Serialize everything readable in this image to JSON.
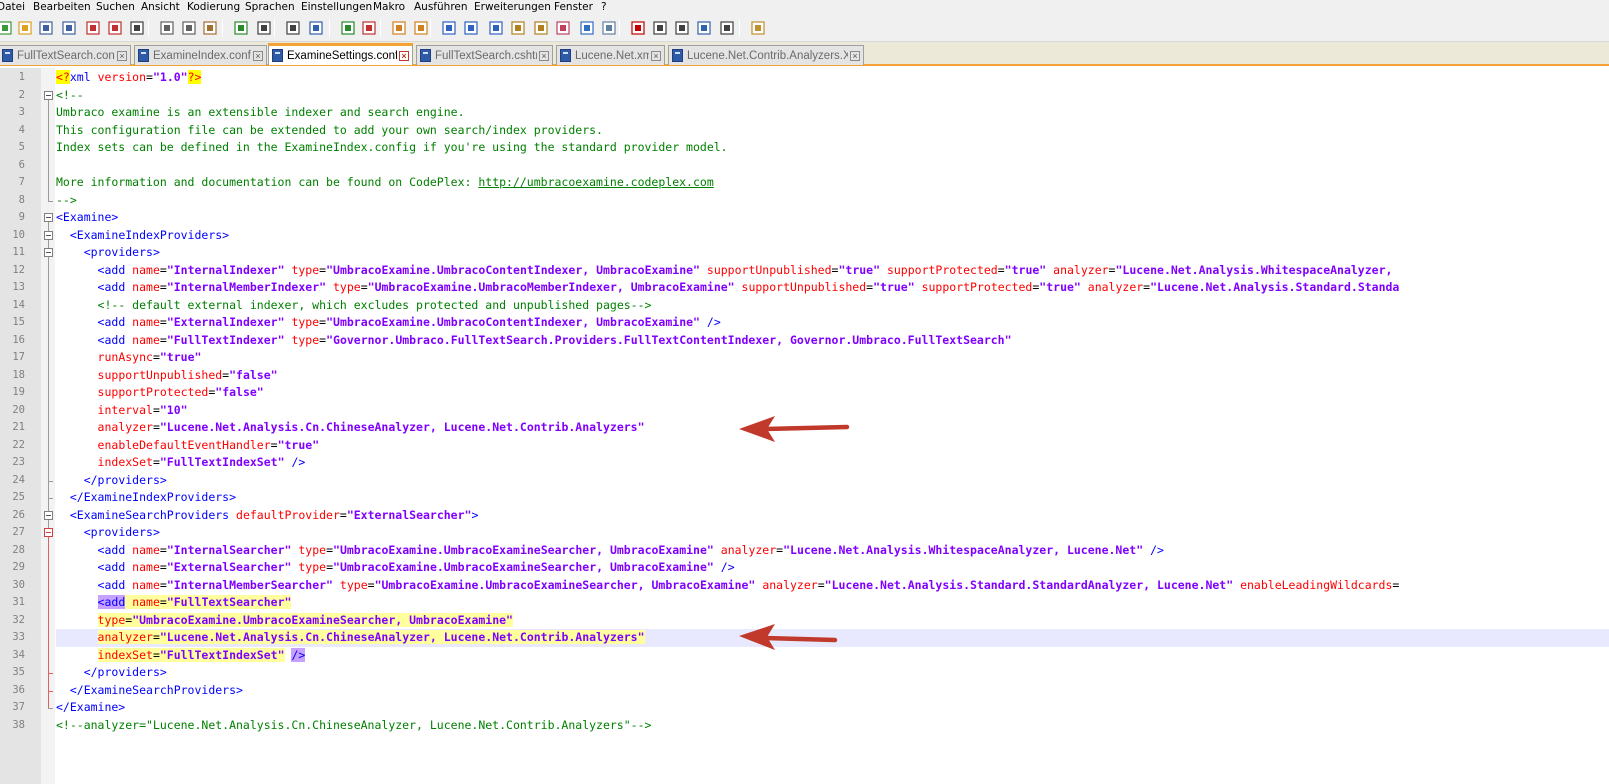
{
  "menu": [
    "Datei",
    "Bearbeiten",
    "Suchen",
    "Ansicht",
    "Kodierung",
    "Sprachen",
    "Einstellungen",
    "Makro",
    "Ausführen",
    "Erweiterungen",
    "Fenster",
    "?"
  ],
  "toolbar_icons": [
    "new-file-icon",
    "open-file-icon",
    "save-icon",
    "save-all-icon",
    "close-icon",
    "close-all-icon",
    "print-icon",
    "cut-icon",
    "copy-icon",
    "paste-icon",
    "undo-icon",
    "redo-icon",
    "find-icon",
    "replace-icon",
    "zoom-in-icon",
    "zoom-out-icon",
    "sync-vertical-icon",
    "sync-horizontal-icon",
    "word-wrap-icon",
    "show-all-chars-icon",
    "indent-guide-icon",
    "user-language-icon",
    "doc-map-icon",
    "function-list-icon",
    "folder-workspace-icon",
    "monitoring-icon",
    "record-macro-icon",
    "stop-macro-icon",
    "play-macro-icon",
    "run-macro-multiple-icon",
    "save-macro-icon",
    "plugin-icon"
  ],
  "tabs": [
    {
      "label": "FullTextSearch.config",
      "active": false
    },
    {
      "label": "ExamineIndex.config",
      "active": false
    },
    {
      "label": "ExamineSettings.config",
      "active": true
    },
    {
      "label": "FullTextSearch.cshtml",
      "active": false
    },
    {
      "label": "Lucene.Net.xml",
      "active": false
    },
    {
      "label": "Lucene.Net.Contrib.Analyzers.XML",
      "active": false
    }
  ],
  "editor": {
    "current_line": 33,
    "colors": {
      "tag": "#0000ff",
      "attribute": "#ff0000",
      "value": "#8000ff",
      "comment": "#008000",
      "current_line": "#e8e8ff",
      "annotation_arrow": "#c0392b"
    },
    "lines": [
      [
        [
          "pi",
          "<?"
        ],
        [
          "tag",
          "xml "
        ],
        [
          "attr",
          "version"
        ],
        [
          "eq",
          "="
        ],
        [
          "val",
          "\"1.0\""
        ],
        [
          "pi",
          "?>"
        ]
      ],
      [
        [
          "com",
          "<!--"
        ]
      ],
      [
        [
          "com",
          "Umbraco examine is an extensible indexer and search engine."
        ]
      ],
      [
        [
          "com",
          "This configuration file can be extended to add your own search/index providers."
        ]
      ],
      [
        [
          "com",
          "Index sets can be defined in the ExamineIndex.config if you're using the standard provider model."
        ]
      ],
      [],
      [
        [
          "com",
          "More information and documentation can be found on CodePlex: "
        ],
        [
          "link",
          "http://umbracoexamine.codeplex.com"
        ]
      ],
      [
        [
          "com",
          "-->"
        ]
      ],
      [
        [
          "tag",
          "<Examine>"
        ]
      ],
      [
        [
          "eq",
          "  "
        ],
        [
          "tag",
          "<ExamineIndexProviders>"
        ]
      ],
      [
        [
          "eq",
          "    "
        ],
        [
          "tag",
          "<providers>"
        ]
      ],
      [
        [
          "eq",
          "      "
        ],
        [
          "tag",
          "<add "
        ],
        [
          "attr",
          "name"
        ],
        [
          "eq",
          "="
        ],
        [
          "val",
          "\"InternalIndexer\""
        ],
        [
          "eq",
          " "
        ],
        [
          "attr",
          "type"
        ],
        [
          "eq",
          "="
        ],
        [
          "val",
          "\"UmbracoExamine.UmbracoContentIndexer, UmbracoExamine\""
        ],
        [
          "eq",
          " "
        ],
        [
          "attr",
          "supportUnpublished"
        ],
        [
          "eq",
          "="
        ],
        [
          "val",
          "\"true\""
        ],
        [
          "eq",
          " "
        ],
        [
          "attr",
          "supportProtected"
        ],
        [
          "eq",
          "="
        ],
        [
          "val",
          "\"true\""
        ],
        [
          "eq",
          " "
        ],
        [
          "attr",
          "analyzer"
        ],
        [
          "eq",
          "="
        ],
        [
          "val",
          "\"Lucene.Net.Analysis.WhitespaceAnalyzer,"
        ]
      ],
      [
        [
          "eq",
          "      "
        ],
        [
          "tag",
          "<add "
        ],
        [
          "attr",
          "name"
        ],
        [
          "eq",
          "="
        ],
        [
          "val",
          "\"InternalMemberIndexer\""
        ],
        [
          "eq",
          " "
        ],
        [
          "attr",
          "type"
        ],
        [
          "eq",
          "="
        ],
        [
          "val",
          "\"UmbracoExamine.UmbracoMemberIndexer, UmbracoExamine\""
        ],
        [
          "eq",
          " "
        ],
        [
          "attr",
          "supportUnpublished"
        ],
        [
          "eq",
          "="
        ],
        [
          "val",
          "\"true\""
        ],
        [
          "eq",
          " "
        ],
        [
          "attr",
          "supportProtected"
        ],
        [
          "eq",
          "="
        ],
        [
          "val",
          "\"true\""
        ],
        [
          "eq",
          " "
        ],
        [
          "attr",
          "analyzer"
        ],
        [
          "eq",
          "="
        ],
        [
          "val",
          "\"Lucene.Net.Analysis.Standard.Standa"
        ]
      ],
      [
        [
          "eq",
          "      "
        ],
        [
          "com",
          "<!-- default external indexer, which excludes protected and unpublished pages-->"
        ]
      ],
      [
        [
          "eq",
          "      "
        ],
        [
          "tag",
          "<add "
        ],
        [
          "attr",
          "name"
        ],
        [
          "eq",
          "="
        ],
        [
          "val",
          "\"ExternalIndexer\""
        ],
        [
          "eq",
          " "
        ],
        [
          "attr",
          "type"
        ],
        [
          "eq",
          "="
        ],
        [
          "val",
          "\"UmbracoExamine.UmbracoContentIndexer, UmbracoExamine\""
        ],
        [
          "eq",
          " "
        ],
        [
          "tag",
          "/>"
        ]
      ],
      [
        [
          "eq",
          "      "
        ],
        [
          "tag",
          "<add "
        ],
        [
          "attr",
          "name"
        ],
        [
          "eq",
          "="
        ],
        [
          "val",
          "\"FullTextIndexer\""
        ],
        [
          "eq",
          " "
        ],
        [
          "attr",
          "type"
        ],
        [
          "eq",
          "="
        ],
        [
          "val",
          "\"Governor.Umbraco.FullTextSearch.Providers.FullTextContentIndexer, Governor.Umbraco.FullTextSearch\""
        ]
      ],
      [
        [
          "eq",
          "      "
        ],
        [
          "attr",
          "runAsync"
        ],
        [
          "eq",
          "="
        ],
        [
          "val",
          "\"true\""
        ]
      ],
      [
        [
          "eq",
          "      "
        ],
        [
          "attr",
          "supportUnpublished"
        ],
        [
          "eq",
          "="
        ],
        [
          "val",
          "\"false\""
        ]
      ],
      [
        [
          "eq",
          "      "
        ],
        [
          "attr",
          "supportProtected"
        ],
        [
          "eq",
          "="
        ],
        [
          "val",
          "\"false\""
        ]
      ],
      [
        [
          "eq",
          "      "
        ],
        [
          "attr",
          "interval"
        ],
        [
          "eq",
          "="
        ],
        [
          "val",
          "\"10\""
        ]
      ],
      [
        [
          "eq",
          "      "
        ],
        [
          "attr",
          "analyzer"
        ],
        [
          "eq",
          "="
        ],
        [
          "val",
          "\"Lucene.Net.Analysis.Cn.ChineseAnalyzer, Lucene.Net.Contrib.Analyzers\""
        ]
      ],
      [
        [
          "eq",
          "      "
        ],
        [
          "attr",
          "enableDefaultEventHandler"
        ],
        [
          "eq",
          "="
        ],
        [
          "val",
          "\"true\""
        ]
      ],
      [
        [
          "eq",
          "      "
        ],
        [
          "attr",
          "indexSet"
        ],
        [
          "eq",
          "="
        ],
        [
          "val",
          "\"FullTextIndexSet\""
        ],
        [
          "eq",
          " "
        ],
        [
          "tag",
          "/>"
        ]
      ],
      [
        [
          "eq",
          "    "
        ],
        [
          "tag",
          "</providers>"
        ]
      ],
      [
        [
          "eq",
          "  "
        ],
        [
          "tag",
          "</ExamineIndexProviders>"
        ]
      ],
      [
        [
          "eq",
          "  "
        ],
        [
          "tag",
          "<ExamineSearchProviders "
        ],
        [
          "attr",
          "defaultProvider"
        ],
        [
          "eq",
          "="
        ],
        [
          "val",
          "\"ExternalSearcher\""
        ],
        [
          "tag",
          ">"
        ]
      ],
      [
        [
          "eq",
          "    "
        ],
        [
          "tag",
          "<providers>"
        ]
      ],
      [
        [
          "eq",
          "      "
        ],
        [
          "tag",
          "<add "
        ],
        [
          "attr",
          "name"
        ],
        [
          "eq",
          "="
        ],
        [
          "val",
          "\"InternalSearcher\""
        ],
        [
          "eq",
          " "
        ],
        [
          "attr",
          "type"
        ],
        [
          "eq",
          "="
        ],
        [
          "val",
          "\"UmbracoExamine.UmbracoExamineSearcher, UmbracoExamine\""
        ],
        [
          "eq",
          " "
        ],
        [
          "attr",
          "analyzer"
        ],
        [
          "eq",
          "="
        ],
        [
          "val",
          "\"Lucene.Net.Analysis.WhitespaceAnalyzer, Lucene.Net\""
        ],
        [
          "eq",
          " "
        ],
        [
          "tag",
          "/>"
        ]
      ],
      [
        [
          "eq",
          "      "
        ],
        [
          "tag",
          "<add "
        ],
        [
          "attr",
          "name"
        ],
        [
          "eq",
          "="
        ],
        [
          "val",
          "\"ExternalSearcher\""
        ],
        [
          "eq",
          " "
        ],
        [
          "attr",
          "type"
        ],
        [
          "eq",
          "="
        ],
        [
          "val",
          "\"UmbracoExamine.UmbracoExamineSearcher, UmbracoExamine\""
        ],
        [
          "eq",
          " "
        ],
        [
          "tag",
          "/>"
        ]
      ],
      [
        [
          "eq",
          "      "
        ],
        [
          "tag",
          "<add "
        ],
        [
          "attr",
          "name"
        ],
        [
          "eq",
          "="
        ],
        [
          "val",
          "\"InternalMemberSearcher\""
        ],
        [
          "eq",
          " "
        ],
        [
          "attr",
          "type"
        ],
        [
          "eq",
          "="
        ],
        [
          "val",
          "\"UmbracoExamine.UmbracoExamineSearcher, UmbracoExamine\""
        ],
        [
          "eq",
          " "
        ],
        [
          "attr",
          "analyzer"
        ],
        [
          "eq",
          "="
        ],
        [
          "val",
          "\"Lucene.Net.Analysis.Standard.StandardAnalyzer, Lucene.Net\""
        ],
        [
          "eq",
          " "
        ],
        [
          "attr",
          "enableLeadingWildcards"
        ],
        [
          "eq",
          "="
        ]
      ],
      [
        [
          "eq",
          "      "
        ],
        [
          "tag",
          "<add",
          "p"
        ],
        [
          "eq",
          " ",
          "y"
        ],
        [
          "attr",
          "name",
          "y"
        ],
        [
          "eq",
          "=",
          "y"
        ],
        [
          "val",
          "\"FullTextSearcher\"",
          "y"
        ]
      ],
      [
        [
          "eq",
          "      "
        ],
        [
          "attr",
          "type",
          "y"
        ],
        [
          "eq",
          "=",
          "y"
        ],
        [
          "val",
          "\"UmbracoExamine.UmbracoExamineSearcher, UmbracoExamine\"",
          "y"
        ]
      ],
      [
        [
          "eq",
          "      "
        ],
        [
          "attr",
          "analyzer",
          "y"
        ],
        [
          "eq",
          "=",
          "y"
        ],
        [
          "val",
          "\"Lucene.Net.Analysis.Cn.ChineseAnalyzer, Lucene.Net.Contrib.Analyzers\"",
          "y"
        ]
      ],
      [
        [
          "eq",
          "      "
        ],
        [
          "attr",
          "indexSet",
          "y"
        ],
        [
          "eq",
          "=",
          "y"
        ],
        [
          "val",
          "\"FullTextIndexSet\"",
          "y"
        ],
        [
          "eq",
          " "
        ],
        [
          "tag",
          "/>",
          "p"
        ]
      ],
      [
        [
          "eq",
          "    "
        ],
        [
          "tag",
          "</providers>"
        ]
      ],
      [
        [
          "eq",
          "  "
        ],
        [
          "tag",
          "</ExamineSearchProviders>"
        ]
      ],
      [
        [
          "tag",
          "</Examine>"
        ]
      ],
      [
        [
          "com",
          "<!--analyzer=\"Lucene.Net.Analysis.Cn.ChineseAnalyzer, Lucene.Net.Contrib.Analyzers\"-->"
        ]
      ]
    ]
  }
}
